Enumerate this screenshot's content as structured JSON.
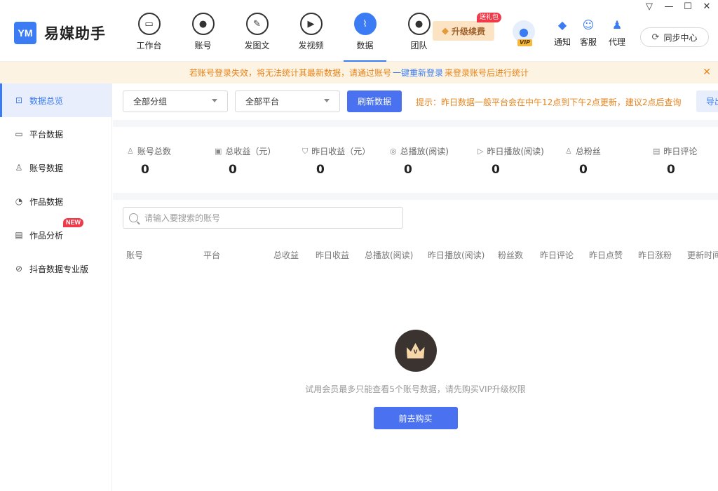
{
  "app": {
    "name": "易媒助手",
    "logo_mark": "YM"
  },
  "nav": [
    {
      "label": "工作台",
      "icon": "monitor-icon",
      "glyph": "▭"
    },
    {
      "label": "账号",
      "icon": "user-icon",
      "glyph": "●"
    },
    {
      "label": "发图文",
      "icon": "feather-icon",
      "glyph": "✎"
    },
    {
      "label": "发视频",
      "icon": "play-icon",
      "glyph": "▶"
    },
    {
      "label": "数据",
      "icon": "chart-icon",
      "glyph": "⌇",
      "active": true
    },
    {
      "label": "团队",
      "icon": "team-icon",
      "glyph": "●"
    }
  ],
  "upgrade": {
    "label": "升级续费",
    "badge": "送礼包"
  },
  "vip_tag": "VIP",
  "tools": [
    {
      "label": "通知",
      "icon": "bell-icon",
      "glyph": "🔔"
    },
    {
      "label": "客服",
      "icon": "service-icon",
      "glyph": "☺"
    },
    {
      "label": "代理",
      "icon": "agent-icon",
      "glyph": "♟"
    }
  ],
  "sync": {
    "label": "同步中心"
  },
  "notice": {
    "before": "若账号登录失效，将无法统计其最新数据，请通过账号",
    "link": "一键重新登录",
    "after": "来登录账号后进行统计"
  },
  "sidebar": [
    {
      "label": "数据总览",
      "icon": "overview-icon",
      "glyph": "⊡",
      "active": true
    },
    {
      "label": "平台数据",
      "icon": "platform-icon",
      "glyph": "▭"
    },
    {
      "label": "账号数据",
      "icon": "account-icon",
      "glyph": "♙"
    },
    {
      "label": "作品数据",
      "icon": "pie-icon",
      "glyph": "◔"
    },
    {
      "label": "作品分析",
      "icon": "report-icon",
      "glyph": "▤",
      "badge": "NEW"
    },
    {
      "label": "抖音数据专业版",
      "icon": "trend-icon",
      "glyph": "⊘"
    }
  ],
  "filters": {
    "group": "全部分组",
    "platform": "全部平台",
    "refresh": "刷新数据",
    "tip": "提示：昨日数据一般平台会在中午12点到下午2点更新，建议2点后查询",
    "export": "导出"
  },
  "stats": [
    {
      "label": "账号总数",
      "value": "0",
      "icon": "user-outline-icon",
      "glyph": "♙"
    },
    {
      "label": "总收益（元）",
      "value": "0",
      "icon": "wallet-icon",
      "glyph": "▣"
    },
    {
      "label": "昨日收益（元）",
      "value": "0",
      "icon": "moneybag-icon",
      "glyph": "⛉"
    },
    {
      "label": "总播放(阅读)",
      "value": "0",
      "icon": "play-count-icon",
      "glyph": "◎"
    },
    {
      "label": "昨日播放(阅读)",
      "value": "0",
      "icon": "play-circle-icon",
      "glyph": "▷"
    },
    {
      "label": "总粉丝",
      "value": "0",
      "icon": "fans-icon",
      "glyph": "♙"
    },
    {
      "label": "昨日评论",
      "value": "0",
      "icon": "comment-icon",
      "glyph": "▤"
    }
  ],
  "search": {
    "placeholder": "请输入要搜索的账号"
  },
  "table": {
    "columns": [
      "账号",
      "平台",
      "总收益",
      "昨日收益",
      "总播放(阅读)",
      "昨日播放(阅读)",
      "粉丝数",
      "昨日评论",
      "昨日点赞",
      "昨日涨粉",
      "更新时间"
    ]
  },
  "empty": {
    "text": "试用会员最多只能查看5个账号数据，请先购买VIP升级权限",
    "button": "前去购买",
    "crown_letter": "v"
  },
  "colors": {
    "accent": "#3b7cf5",
    "button": "#4a72f0",
    "warning": "#e8831a",
    "notice_bg": "#fdf3e3",
    "badge": "#f03a4a"
  }
}
